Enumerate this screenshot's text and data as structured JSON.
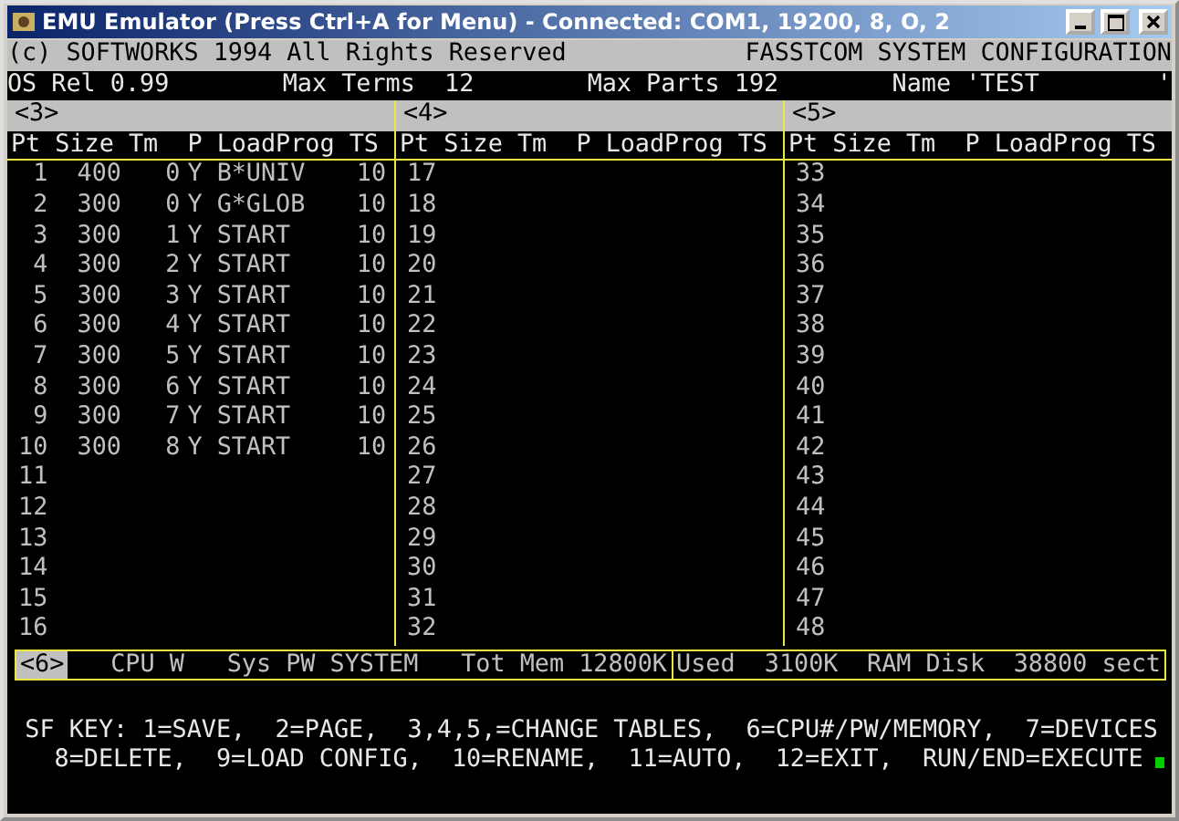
{
  "window": {
    "title": "EMU Emulator (Press Ctrl+A for Menu) - Connected: COM1, 19200, 8, O, 2"
  },
  "banner": {
    "copyright": "(c) SOFTWORKS 1994 All Rights Reserved",
    "system_title": "FASSTCOM SYSTEM CONFIGURATION"
  },
  "info": {
    "os_rel": "OS Rel 0.99",
    "max_terms": "Max Terms  12",
    "max_parts": "Max Parts 192",
    "name": "Name 'TEST        '"
  },
  "tables": [
    {
      "label": "<3>",
      "columns": [
        "Pt",
        "Size",
        "Tm",
        "P",
        "LoadProg",
        "TS"
      ],
      "rows": [
        {
          "pt": "1",
          "size": "400",
          "tm": "0",
          "p": "Y",
          "load_prog": "B*UNIV",
          "ts": "10"
        },
        {
          "pt": "2",
          "size": "300",
          "tm": "0",
          "p": "Y",
          "load_prog": "G*GLOB",
          "ts": "10"
        },
        {
          "pt": "3",
          "size": "300",
          "tm": "1",
          "p": "Y",
          "load_prog": "START",
          "ts": "10"
        },
        {
          "pt": "4",
          "size": "300",
          "tm": "2",
          "p": "Y",
          "load_prog": "START",
          "ts": "10"
        },
        {
          "pt": "5",
          "size": "300",
          "tm": "3",
          "p": "Y",
          "load_prog": "START",
          "ts": "10"
        },
        {
          "pt": "6",
          "size": "300",
          "tm": "4",
          "p": "Y",
          "load_prog": "START",
          "ts": "10"
        },
        {
          "pt": "7",
          "size": "300",
          "tm": "5",
          "p": "Y",
          "load_prog": "START",
          "ts": "10"
        },
        {
          "pt": "8",
          "size": "300",
          "tm": "6",
          "p": "Y",
          "load_prog": "START",
          "ts": "10"
        },
        {
          "pt": "9",
          "size": "300",
          "tm": "7",
          "p": "Y",
          "load_prog": "START",
          "ts": "10"
        },
        {
          "pt": "10",
          "size": "300",
          "tm": "8",
          "p": "Y",
          "load_prog": "START",
          "ts": "10"
        },
        {
          "pt": "11"
        },
        {
          "pt": "12"
        },
        {
          "pt": "13"
        },
        {
          "pt": "14"
        },
        {
          "pt": "15"
        },
        {
          "pt": "16"
        }
      ]
    },
    {
      "label": "<4>",
      "columns": [
        "Pt",
        "Size",
        "Tm",
        "P",
        "LoadProg",
        "TS"
      ],
      "rows": [
        {
          "pt": "17"
        },
        {
          "pt": "18"
        },
        {
          "pt": "19"
        },
        {
          "pt": "20"
        },
        {
          "pt": "21"
        },
        {
          "pt": "22"
        },
        {
          "pt": "23"
        },
        {
          "pt": "24"
        },
        {
          "pt": "25"
        },
        {
          "pt": "26"
        },
        {
          "pt": "27"
        },
        {
          "pt": "28"
        },
        {
          "pt": "29"
        },
        {
          "pt": "30"
        },
        {
          "pt": "31"
        },
        {
          "pt": "32"
        }
      ]
    },
    {
      "label": "<5>",
      "columns": [
        "Pt",
        "Size",
        "Tm",
        "P",
        "LoadProg",
        "TS"
      ],
      "rows": [
        {
          "pt": "33"
        },
        {
          "pt": "34"
        },
        {
          "pt": "35"
        },
        {
          "pt": "36"
        },
        {
          "pt": "37"
        },
        {
          "pt": "38"
        },
        {
          "pt": "39"
        },
        {
          "pt": "40"
        },
        {
          "pt": "41"
        },
        {
          "pt": "42"
        },
        {
          "pt": "43"
        },
        {
          "pt": "44"
        },
        {
          "pt": "45"
        },
        {
          "pt": "46"
        },
        {
          "pt": "47"
        },
        {
          "pt": "48"
        }
      ]
    }
  ],
  "status_bar": {
    "field": {
      "label": "<6>",
      "selected": true
    },
    "left": [
      "CPU W",
      "Sys PW SYSTEM",
      "Tot Mem 12800K"
    ],
    "right": [
      "Used  3100K",
      "RAM Disk",
      "38800 sect"
    ]
  },
  "function_keys": [
    "SF KEY: 1=SAVE,  2=PAGE,  3,4,5,=CHANGE TABLES,  6=CPU#/PW/MEMORY,  7=DEVICES",
    "8=DELETE,  9=LOAD CONFIG,  10=RENAME,  11=AUTO,  12=EXIT,  RUN/END=EXECUTE"
  ]
}
